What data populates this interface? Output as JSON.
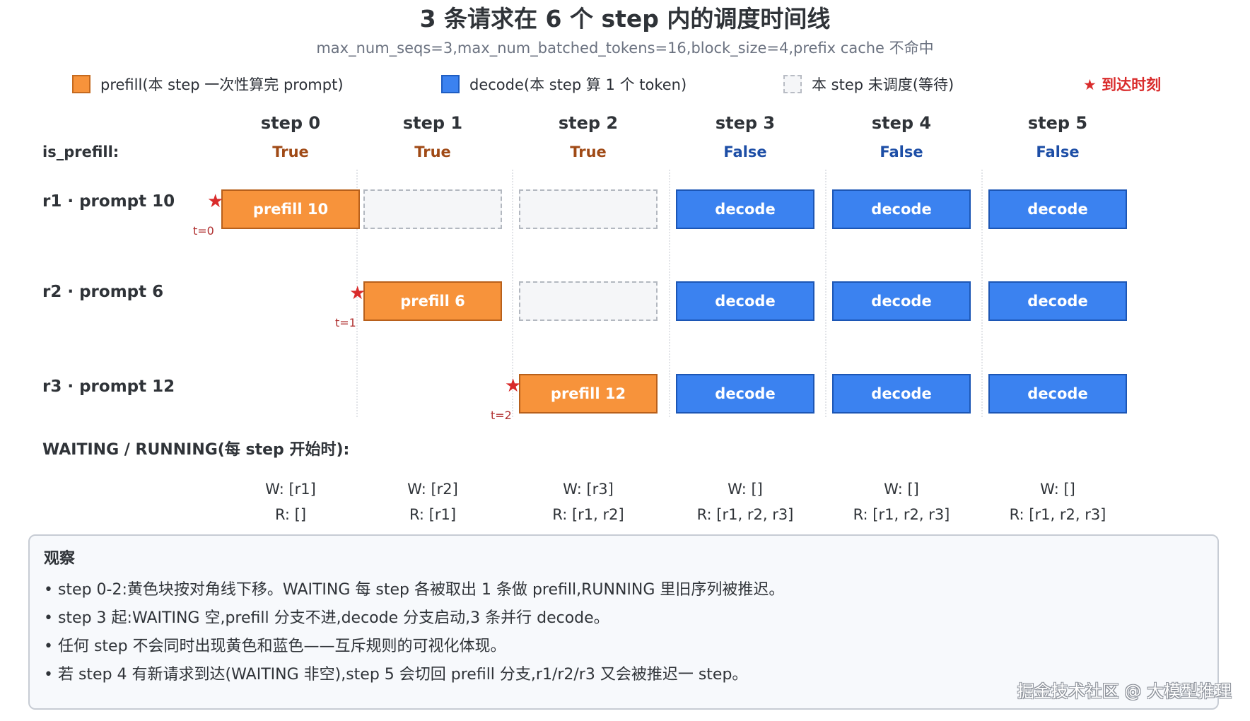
{
  "title": "3 条请求在 6 个 step 内的调度时间线",
  "subtitle": "max_num_seqs=3,max_num_batched_tokens=16,block_size=4,prefix cache 不命中",
  "legend": {
    "prefill": "prefill(本 step 一次性算完 prompt)",
    "decode": "decode(本 step 算 1 个 token)",
    "waiting": "本 step 未调度(等待)",
    "arrival": "★ 到达时刻"
  },
  "colors": {
    "prefill": "#f7933b",
    "decode": "#3b82f0",
    "waiting": "#f5f6f8",
    "arrival": "#d92b2b"
  },
  "is_prefill_label": "is_prefill:",
  "steps": [
    {
      "label": "step 0",
      "is_prefill": "True",
      "waiting": "W: [r1]",
      "running": "R: []"
    },
    {
      "label": "step 1",
      "is_prefill": "True",
      "waiting": "W: [r2]",
      "running": "R: [r1]"
    },
    {
      "label": "step 2",
      "is_prefill": "True",
      "waiting": "W: [r3]",
      "running": "R: [r1, r2]"
    },
    {
      "label": "step 3",
      "is_prefill": "False",
      "waiting": "W: []",
      "running": "R: [r1, r2, r3]"
    },
    {
      "label": "step 4",
      "is_prefill": "False",
      "waiting": "W: []",
      "running": "R: [r1, r2, r3]"
    },
    {
      "label": "step 5",
      "is_prefill": "False",
      "waiting": "W: []",
      "running": "R: [r1, r2, r3]"
    }
  ],
  "requests": [
    {
      "label": "r1 · prompt 10",
      "arrival_star": "★",
      "arrival_label": "t=0",
      "cells": [
        {
          "kind": "prefill",
          "text": "prefill 10"
        },
        {
          "kind": "wait",
          "text": ""
        },
        {
          "kind": "wait",
          "text": ""
        },
        {
          "kind": "decode",
          "text": "decode"
        },
        {
          "kind": "decode",
          "text": "decode"
        },
        {
          "kind": "decode",
          "text": "decode"
        }
      ]
    },
    {
      "label": "r2 · prompt 6",
      "arrival_star": "★",
      "arrival_label": "t=1",
      "cells": [
        {
          "kind": "none",
          "text": ""
        },
        {
          "kind": "prefill",
          "text": "prefill 6"
        },
        {
          "kind": "wait",
          "text": ""
        },
        {
          "kind": "decode",
          "text": "decode"
        },
        {
          "kind": "decode",
          "text": "decode"
        },
        {
          "kind": "decode",
          "text": "decode"
        }
      ]
    },
    {
      "label": "r3 · prompt 12",
      "arrival_star": "★",
      "arrival_label": "t=2",
      "cells": [
        {
          "kind": "none",
          "text": ""
        },
        {
          "kind": "none",
          "text": ""
        },
        {
          "kind": "prefill",
          "text": "prefill 12"
        },
        {
          "kind": "decode",
          "text": "decode"
        },
        {
          "kind": "decode",
          "text": "decode"
        },
        {
          "kind": "decode",
          "text": "decode"
        }
      ]
    }
  ],
  "waiting_running_heading": "WAITING / RUNNING(每 step 开始时):",
  "observation": {
    "title": "观察",
    "items": [
      "• step 0-2:黄色块按对角线下移。WAITING 每 step 各被取出 1 条做 prefill,RUNNING 里旧序列被推迟。",
      "• step 3 起:WAITING 空,prefill 分支不进,decode 分支启动,3 条并行 decode。",
      "• 任何 step 不会同时出现黄色和蓝色——互斥规则的可视化体现。",
      "• 若 step 4 有新请求到达(WAITING 非空),step 5 会切回 prefill 分支,r1/r2/r3 又会被推迟一 step。"
    ]
  },
  "watermark": "掘金技术社区 @ 大模型推理"
}
